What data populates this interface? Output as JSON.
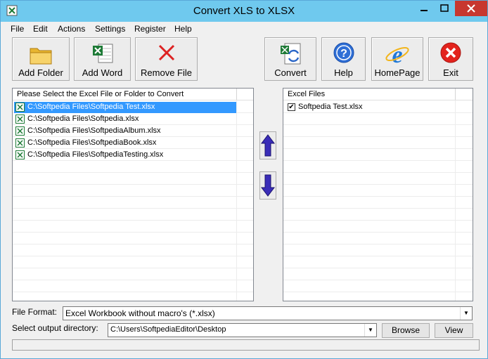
{
  "window": {
    "title": "Convert XLS to XLSX"
  },
  "menu": [
    "File",
    "Edit",
    "Actions",
    "Settings",
    "Register",
    "Help"
  ],
  "toolbar": {
    "add_folder": "Add Folder",
    "add_word": "Add Word",
    "remove_file": "Remove File",
    "convert": "Convert",
    "help": "Help",
    "homepage": "HomePage",
    "exit": "Exit"
  },
  "left_panel": {
    "header": "Please Select the Excel File or Folder to Convert",
    "files": [
      "C:\\Softpedia Files\\Softpedia Test.xlsx",
      "C:\\Softpedia Files\\Softpedia.xlsx",
      "C:\\Softpedia Files\\SoftpediaAlbum.xlsx",
      "C:\\Softpedia Files\\SoftpediaBook.xlsx",
      "C:\\Softpedia Files\\SoftpediaTesting.xlsx"
    ]
  },
  "right_panel": {
    "header": "Excel Files",
    "files": [
      {
        "name": "Softpedia Test.xlsx",
        "checked": true
      }
    ]
  },
  "options": {
    "file_format_label": "File Format:",
    "file_format_value": "Excel Workbook without macro's (*.xlsx)",
    "output_dir_label": "Select  output directory:",
    "output_dir_value": "C:\\Users\\SoftpediaEditor\\Desktop",
    "browse": "Browse",
    "view": "View"
  },
  "colors": {
    "titlebar": "#6fc9ee",
    "selection": "#3399ff",
    "close": "#c7372f"
  }
}
